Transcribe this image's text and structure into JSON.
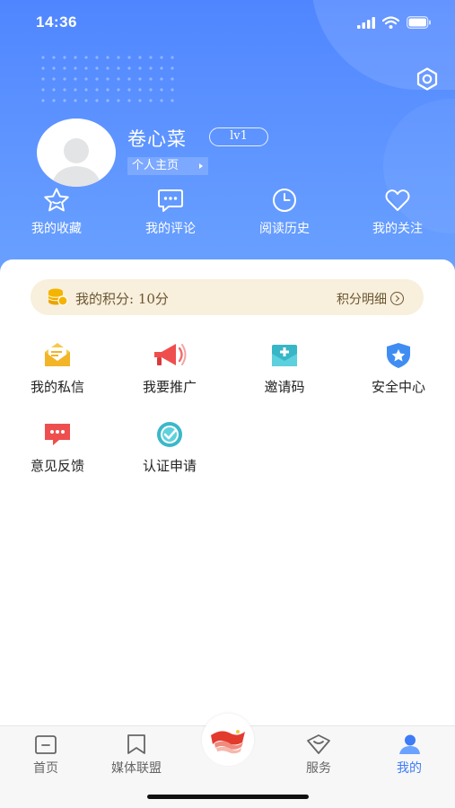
{
  "status_bar": {
    "time": "14:36"
  },
  "profile": {
    "username": "卷心菜",
    "level": "lv1",
    "homepage_link": "个人主页"
  },
  "quick_links": [
    {
      "label": "我的收藏",
      "icon": "star-icon"
    },
    {
      "label": "我的评论",
      "icon": "comment-icon"
    },
    {
      "label": "阅读历史",
      "icon": "clock-icon"
    },
    {
      "label": "我的关注",
      "icon": "heart-icon"
    }
  ],
  "points": {
    "label": "我的积分: 10分",
    "detail_link": "积分明细"
  },
  "services": [
    {
      "label": "我的私信",
      "icon": "envelope-icon"
    },
    {
      "label": "我要推广",
      "icon": "megaphone-icon"
    },
    {
      "label": "邀请码",
      "icon": "invite-code-icon"
    },
    {
      "label": "安全中心",
      "icon": "shield-icon"
    },
    {
      "label": "意见反馈",
      "icon": "feedback-icon"
    },
    {
      "label": "认证申请",
      "icon": "verified-icon"
    }
  ],
  "tabbar": {
    "items": [
      {
        "label": "首页",
        "icon": "home-icon"
      },
      {
        "label": "媒体联盟",
        "icon": "bookmark-icon"
      },
      {
        "label": "服务",
        "icon": "service-icon"
      },
      {
        "label": "我的",
        "icon": "profile-icon"
      }
    ],
    "active": "我的"
  },
  "colors": {
    "header_blue": "#5d93ff",
    "active_tab": "#3d7cf6",
    "points_bg": "#f8efdc"
  }
}
